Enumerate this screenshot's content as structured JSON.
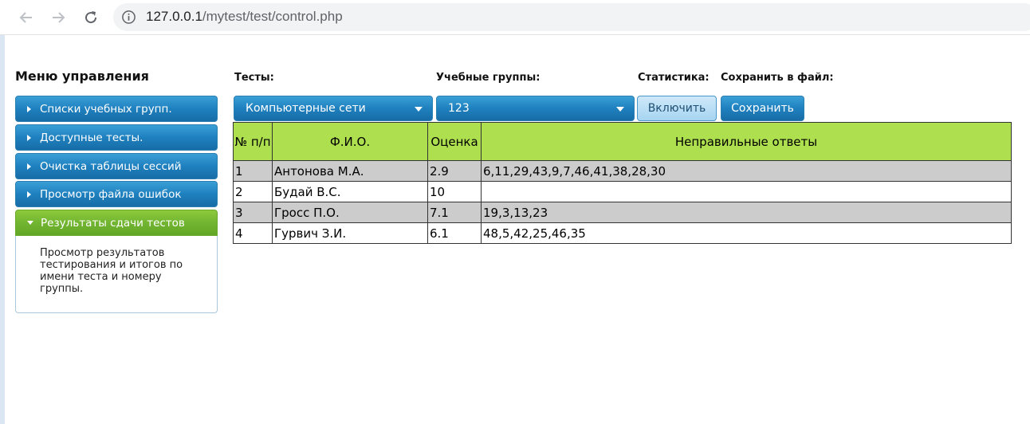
{
  "browser": {
    "url_host": "127.0.0.1",
    "url_path": "/mytest/test/control.php"
  },
  "sidebar": {
    "title": "Меню управления",
    "items": [
      {
        "label": "Списки учебных групп."
      },
      {
        "label": "Доступные тесты."
      },
      {
        "label": "Очистка таблицы сессий"
      },
      {
        "label": "Просмотр файла ошибок"
      },
      {
        "label": "Результаты сдачи тестов"
      }
    ],
    "active_description": "Просмотр результатов тестирования и итогов по имени теста и номеру группы."
  },
  "controls": {
    "tests_label": "Тесты:",
    "groups_label": "Учебные группы:",
    "stats_label": "Статистика:",
    "save_file_label": "Сохранить в файл:",
    "tests_selected": "Компьютерные сети",
    "group_selected": "123",
    "enable_button": "Включить",
    "save_button": "Сохранить"
  },
  "table": {
    "headers": [
      "№ п/п",
      "Ф.И.О.",
      "Оценка",
      "Неправильные ответы"
    ],
    "rows": [
      {
        "num": "1",
        "name": "Антонова М.А.",
        "grade": "2.9",
        "wrong": "6,11,29,43,9,7,46,41,38,28,30"
      },
      {
        "num": "2",
        "name": "Будай В.С.",
        "grade": "10",
        "wrong": ""
      },
      {
        "num": "3",
        "name": "Гросс П.О.",
        "grade": "7.1",
        "wrong": "19,3,13,23"
      },
      {
        "num": "4",
        "name": "Гурвич З.И.",
        "grade": "6.1",
        "wrong": "48,5,42,25,46,35"
      }
    ]
  },
  "colors": {
    "menu_blue": "#1f80bf",
    "menu_active_green": "#72b531",
    "table_header_green": "#addf4f",
    "row_gray": "#cccccc"
  }
}
